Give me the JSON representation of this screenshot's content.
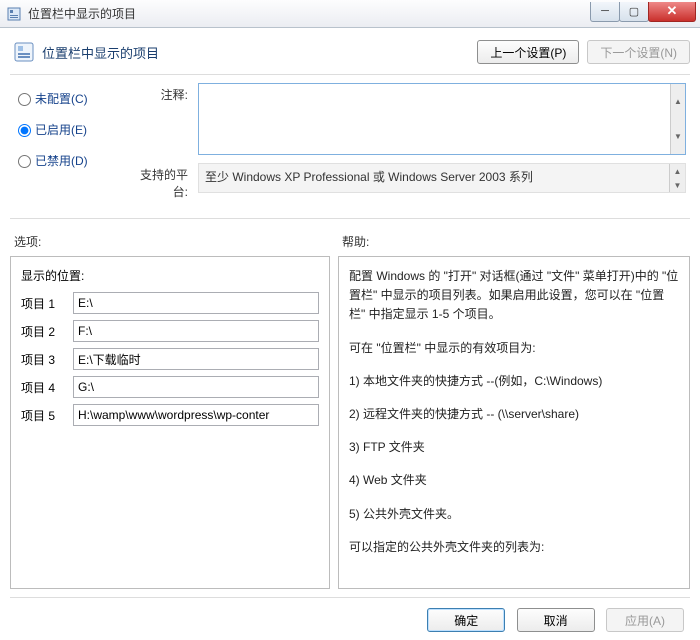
{
  "window": {
    "title": "位置栏中显示的项目"
  },
  "header": {
    "title": "位置栏中显示的项目",
    "prev_btn": "上一个设置(P)",
    "next_btn": "下一个设置(N)"
  },
  "radios": {
    "not_configured": "未配置(C)",
    "enabled": "已启用(E)",
    "disabled": "已禁用(D)",
    "selected": "enabled"
  },
  "comment": {
    "label": "注释:",
    "value": ""
  },
  "platform": {
    "label": "支持的平台:",
    "value": "至少 Windows XP Professional 或 Windows Server 2003 系列"
  },
  "lowlabels": {
    "left": "选项:",
    "right": "帮助:"
  },
  "options": {
    "section_title": "显示的位置:",
    "items": [
      {
        "label": "项目 1",
        "value": "E:\\"
      },
      {
        "label": "项目 2",
        "value": "F:\\"
      },
      {
        "label": "项目 3",
        "value": "E:\\下载临时"
      },
      {
        "label": "项目 4",
        "value": "G:\\"
      },
      {
        "label": "项目 5",
        "value": "H:\\wamp\\www\\wordpress\\wp-conter"
      }
    ]
  },
  "help": {
    "p1": "配置 Windows 的 \"打开\" 对话框(通过 \"文件\" 菜单打开)中的 \"位置栏\" 中显示的项目列表。如果启用此设置，您可以在 \"位置栏\" 中指定显示 1-5 个项目。",
    "p2": "可在 \"位置栏\" 中显示的有效项目为:",
    "p3": "1) 本地文件夹的快捷方式 --(例如，C:\\Windows)",
    "p4": "2) 远程文件夹的快捷方式 -- (\\\\server\\share)",
    "p5": "3) FTP 文件夹",
    "p6": "4) Web 文件夹",
    "p7": "5) 公共外壳文件夹。",
    "p8": "可以指定的公共外壳文件夹的列表为:"
  },
  "buttons": {
    "ok": "确定",
    "cancel": "取消",
    "apply": "应用(A)"
  }
}
